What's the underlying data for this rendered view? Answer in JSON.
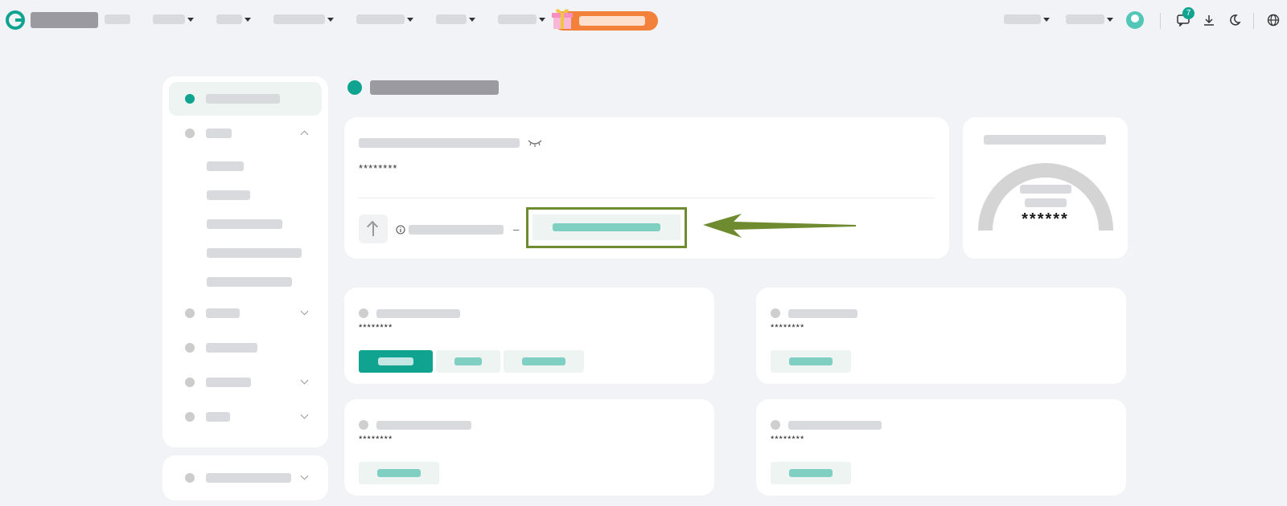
{
  "theme": {
    "accent": "#10a390",
    "promo": "#f4813a",
    "highlight": "#6e8b30"
  },
  "header": {
    "nav": [
      {
        "id": "fiat",
        "dropdown": false
      },
      {
        "id": "market",
        "dropdown": true
      },
      {
        "id": "spot",
        "dropdown": true
      },
      {
        "id": "futures",
        "dropdown": true
      },
      {
        "id": "finance",
        "dropdown": true
      },
      {
        "id": "stocks",
        "dropdown": true
      },
      {
        "id": "more",
        "dropdown": true
      }
    ],
    "right": [
      {
        "id": "assets",
        "dropdown": true
      },
      {
        "id": "orders",
        "dropdown": true
      }
    ],
    "badge": "7",
    "icons": [
      "chat-icon",
      "download-icon",
      "moon-icon",
      "globe-icon"
    ]
  },
  "sidebar": {
    "items": [
      {
        "id": "overview",
        "active": true
      },
      {
        "id": "spot",
        "expanded": true
      },
      {
        "id": "margin",
        "expanded": false
      },
      {
        "id": "futures",
        "expanded": null
      },
      {
        "id": "finance",
        "expanded": false
      },
      {
        "id": "amm",
        "expanded": false
      }
    ],
    "spot_sub": [
      "assets",
      "deposit",
      "withdraw",
      "deposit-records",
      "withdraw-records"
    ],
    "secondary": {
      "id": "history",
      "expanded": false
    }
  },
  "total": {
    "masked": "********",
    "pnl_dash": "–"
  },
  "distribution": {
    "masked": "******"
  },
  "accounts": [
    {
      "id": "spot",
      "masked": "********",
      "buttons": [
        "deposit",
        "withdraw",
        "transfer"
      ]
    },
    {
      "id": "margin",
      "masked": "********",
      "buttons": [
        "transfer"
      ]
    },
    {
      "id": "futures",
      "masked": "********",
      "buttons": [
        "transfer"
      ]
    },
    {
      "id": "finance",
      "masked": "********",
      "buttons": [
        "transfer"
      ]
    }
  ]
}
